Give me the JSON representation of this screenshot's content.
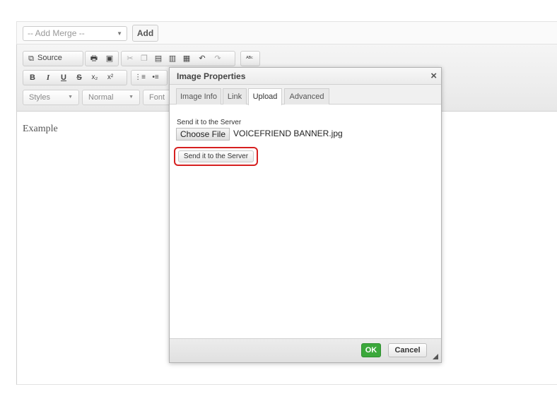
{
  "merge": {
    "select_value": "-- Add Merge --",
    "add_label": "Add"
  },
  "toolbar": {
    "source_label": "Source",
    "styles_label": "Styles",
    "format_label": "Normal",
    "font_label": "Font",
    "bold": "B",
    "italic": "I",
    "underline": "U",
    "strike": "S"
  },
  "editor": {
    "content": "Example"
  },
  "dialog": {
    "title": "Image Properties",
    "close": "×",
    "tabs": [
      "Image Info",
      "Link",
      "Upload",
      "Advanced"
    ],
    "active_tab": "Upload",
    "upload_label": "Send it to the Server",
    "choose_file_label": "Choose File",
    "file_name": "VOICEFRIEND BANNER.jpg",
    "send_button": "Send it to the Server",
    "ok": "OK",
    "cancel": "Cancel"
  },
  "colors": {
    "ok_green": "#3ba83b",
    "highlight_red": "#d62020"
  }
}
